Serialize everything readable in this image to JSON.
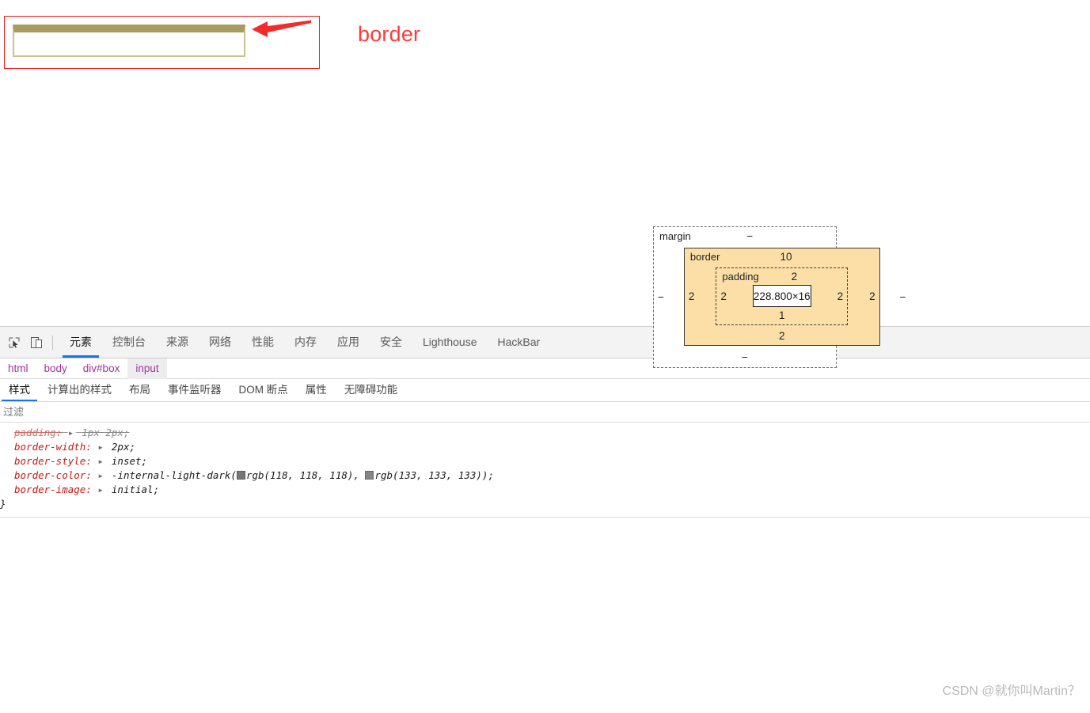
{
  "page_area": {
    "annotation_label": "border",
    "annotation_label_color": "#fa3c3c",
    "annotation_box_color": "#e81a1a",
    "arrow_color": "#f42b2b",
    "input_border_top_color": "#a89a60",
    "input_border_side_color": "#cdc08a"
  },
  "devtools": {
    "toolbar_icons": [
      {
        "name": "inspect-element-icon"
      },
      {
        "name": "device-toolbar-icon"
      }
    ],
    "tabs": [
      {
        "label": "元素",
        "selected": true
      },
      {
        "label": "控制台",
        "selected": false
      },
      {
        "label": "来源",
        "selected": false
      },
      {
        "label": "网络",
        "selected": false
      },
      {
        "label": "性能",
        "selected": false
      },
      {
        "label": "内存",
        "selected": false
      },
      {
        "label": "应用",
        "selected": false
      },
      {
        "label": "安全",
        "selected": false
      },
      {
        "label": "Lighthouse",
        "selected": false
      },
      {
        "label": "HackBar",
        "selected": false
      }
    ],
    "breadcrumbs": [
      {
        "label": "html",
        "active": false
      },
      {
        "label": "body",
        "active": false
      },
      {
        "label": "div#box",
        "active": false
      },
      {
        "label": "input",
        "active": true
      }
    ],
    "subtabs": [
      {
        "label": "样式",
        "selected": true
      },
      {
        "label": "计算出的样式",
        "selected": false
      },
      {
        "label": "布局",
        "selected": false
      },
      {
        "label": "事件监听器",
        "selected": false
      },
      {
        "label": "DOM 断点",
        "selected": false
      },
      {
        "label": "属性",
        "selected": false
      },
      {
        "label": "无障碍功能",
        "selected": false
      }
    ],
    "filter": {
      "placeholder": "过滤",
      "value": ""
    },
    "css_rules": {
      "declarations": [
        {
          "property": "padding",
          "value": "1px 2px;",
          "overridden": true,
          "has_disclosure": true
        },
        {
          "property": "border-width",
          "value": "2px;",
          "overridden": false,
          "has_disclosure": true
        },
        {
          "property": "border-style",
          "value": "inset;",
          "overridden": false,
          "has_disclosure": true
        },
        {
          "property": "border-color",
          "value": "-internal-light-dark(",
          "overridden": false,
          "has_disclosure": true,
          "colors": [
            {
              "swatch": "#767676",
              "text": "rgb(118, 118, 118), "
            },
            {
              "swatch": "#858585",
              "text": "rgb(133, 133, 133));"
            }
          ]
        },
        {
          "property": "border-image",
          "value": "initial;",
          "overridden": false,
          "has_disclosure": true
        }
      ],
      "closing_brace": "}"
    },
    "box_model": {
      "margin_label": "margin",
      "margin_top": "−",
      "margin_right": "−",
      "margin_bottom": "−",
      "margin_left": "−",
      "border_label": "border",
      "border_top": "10",
      "border_right": "2",
      "border_bottom": "2",
      "border_left": "2",
      "padding_label": "padding",
      "padding_top": "2",
      "padding_right": "2",
      "padding_bottom": "1",
      "padding_left": "2",
      "content_size": "228.800×16"
    }
  },
  "watermark": "CSDN @就你叫Martin？"
}
